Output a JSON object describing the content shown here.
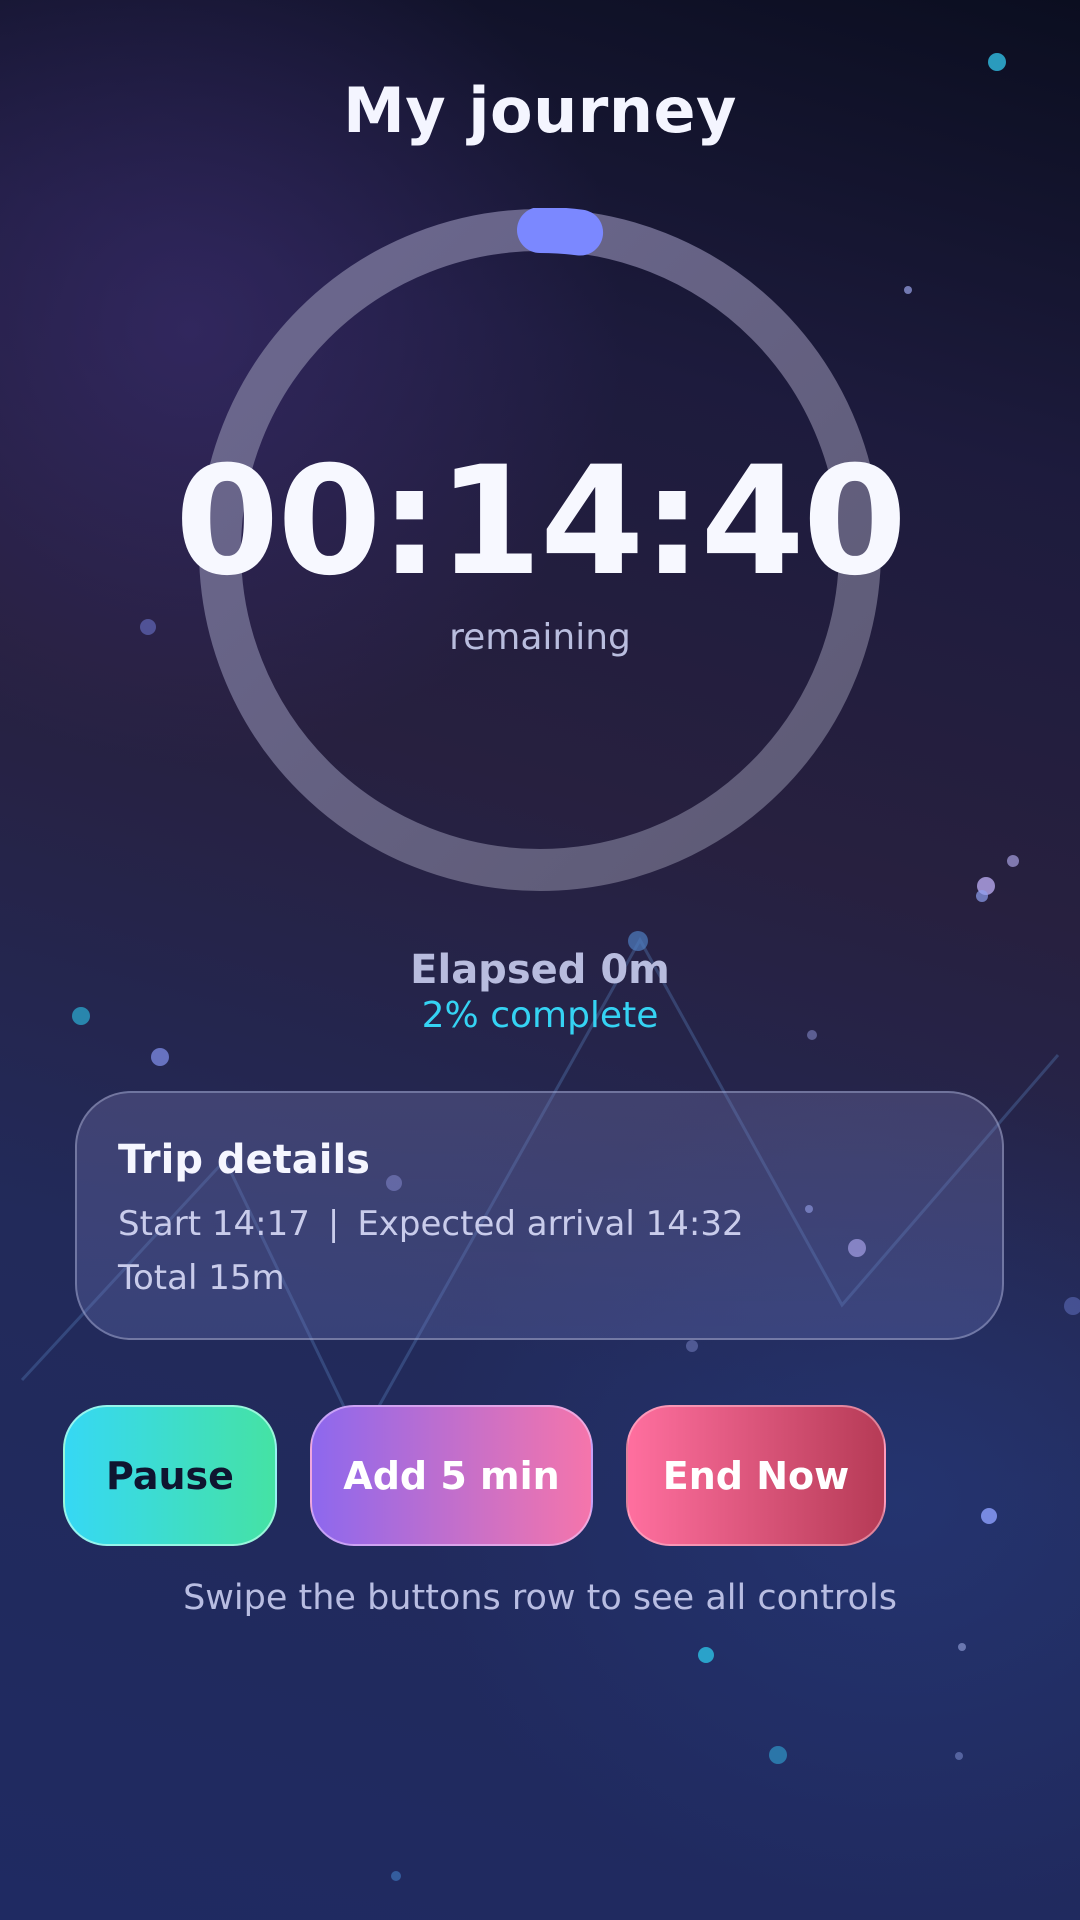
{
  "header": {
    "title": "My journey"
  },
  "timer": {
    "time": "00:14:40",
    "sub_label": "remaining",
    "progress_fraction": 0.02
  },
  "status": {
    "elapsed": "Elapsed 0m",
    "complete": "2% complete"
  },
  "trip": {
    "title": "Trip details",
    "start": "Start 14:17",
    "separator": "|",
    "arrival": "Expected arrival 14:32",
    "total": "Total 15m"
  },
  "controls": {
    "pause_label": "Pause",
    "add_label": "Add 5 min",
    "end_label": "End Now"
  },
  "hint": "Swipe the buttons row to see all controls",
  "colors": {
    "accent_cyan": "#35d3f3",
    "progress": "#7b88ff",
    "track": "#63607f"
  }
}
